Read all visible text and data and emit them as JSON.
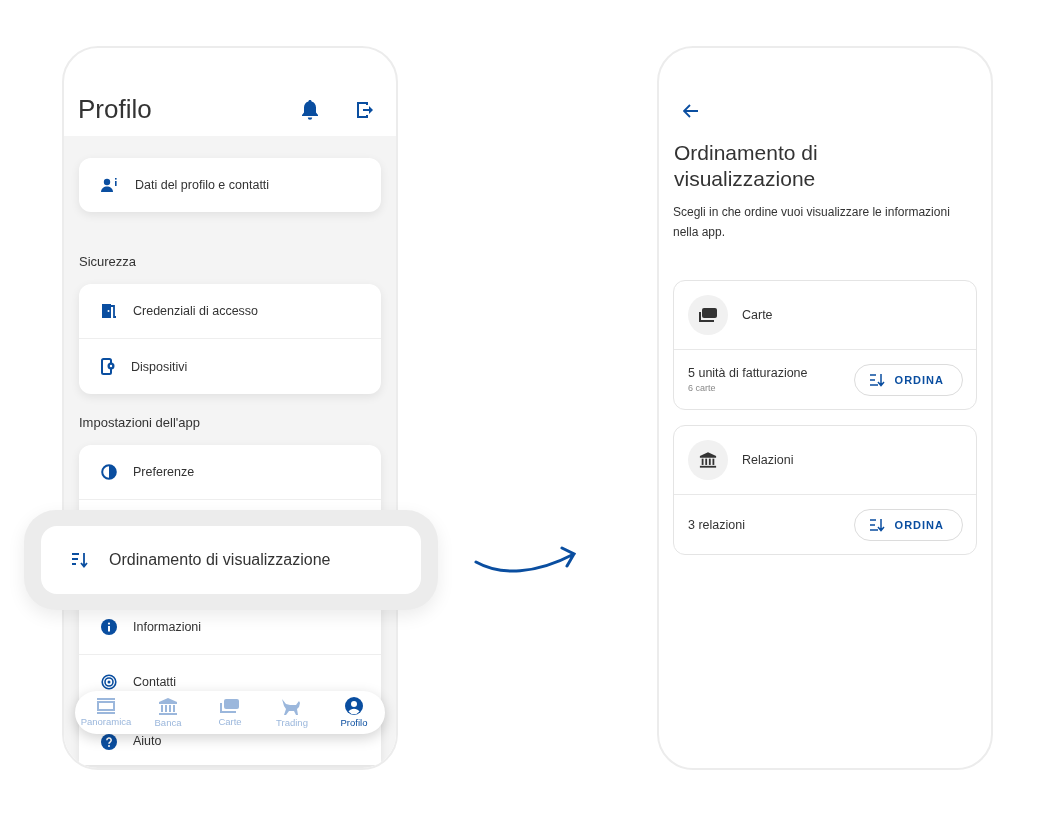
{
  "profile_screen": {
    "title": "Profilo",
    "groups": [
      {
        "items": [
          {
            "label": "Dati del profilo e contatti"
          }
        ]
      },
      {
        "heading": "Sicurezza",
        "items": [
          {
            "label": "Credenziali di accesso"
          },
          {
            "label": "Dispositivi"
          }
        ]
      },
      {
        "heading": "Impostazioni dell'app",
        "items": [
          {
            "label": "Preferenze"
          },
          {
            "label": "Informazioni"
          },
          {
            "label": "Contatti"
          },
          {
            "label": "Aiuto"
          }
        ]
      }
    ],
    "highlighted_item": {
      "label": "Ordinamento di visualizzazione"
    },
    "bottom_nav": [
      {
        "label": "Panoramica",
        "selected": false
      },
      {
        "label": "Banca",
        "selected": false
      },
      {
        "label": "Carte",
        "selected": false
      },
      {
        "label": "Trading",
        "selected": false
      },
      {
        "label": "Profilo",
        "selected": true
      }
    ]
  },
  "sort_screen": {
    "title": "Ordinamento di visualizzazione",
    "description": "Scegli in che ordine vuoi visualizzare le informazioni nella app.",
    "sections": [
      {
        "name": "Carte",
        "summary": "5 unità di fatturazione",
        "detail": "6 carte",
        "button": "ORDINA"
      },
      {
        "name": "Relazioni",
        "summary": "3 relazioni",
        "button": "ORDINA"
      }
    ]
  }
}
